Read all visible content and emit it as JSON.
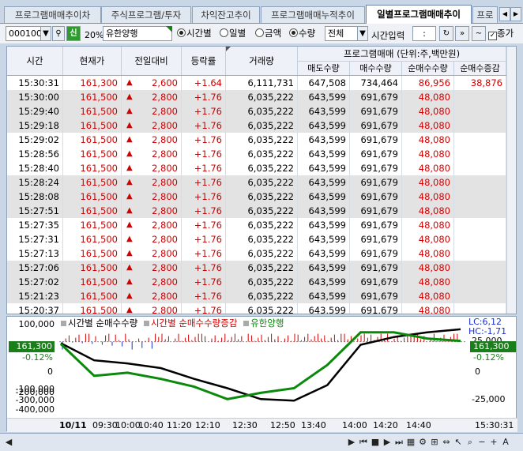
{
  "tabs": [
    {
      "label": "프로그램매매추이차"
    },
    {
      "label": "주식프로그램/투자"
    },
    {
      "label": "차익잔고추이"
    },
    {
      "label": "프로그램매매누적추이"
    },
    {
      "label": "일별프로그램매매추이"
    },
    {
      "label": "프로"
    }
  ],
  "toolbar": {
    "code": "000100",
    "badge_new": "신",
    "margin": "20%",
    "stock_name": "유한양행",
    "radio_time": "시간별",
    "radio_day": "일별",
    "radio_amount": "금액",
    "radio_qty": "수량",
    "filter": "전체",
    "time_input_label": "시간입력",
    "time_value": ":",
    "close_price_label": "종가"
  },
  "table": {
    "headers": {
      "time": "시간",
      "price": "현재가",
      "change": "전일대비",
      "rate": "등락률",
      "volume": "거래량",
      "program_group": "프로그램매매 (단위:주,백만원)",
      "sell": "매도수량",
      "buy": "매수수량",
      "net": "순매수수량",
      "net_delta": "순매수증감"
    },
    "rows": [
      {
        "time": "15:30:31",
        "price": "161,300",
        "change": "2,600",
        "rate": "+1.64",
        "volume": "6,111,731",
        "sell": "647,508",
        "buy": "734,464",
        "net": "86,956",
        "delta": "38,876"
      },
      {
        "time": "15:30:00",
        "price": "161,500",
        "change": "2,800",
        "rate": "+1.76",
        "volume": "6,035,222",
        "sell": "643,599",
        "buy": "691,679",
        "net": "48,080",
        "delta": ""
      },
      {
        "time": "15:29:40",
        "price": "161,500",
        "change": "2,800",
        "rate": "+1.76",
        "volume": "6,035,222",
        "sell": "643,599",
        "buy": "691,679",
        "net": "48,080",
        "delta": ""
      },
      {
        "time": "15:29:18",
        "price": "161,500",
        "change": "2,800",
        "rate": "+1.76",
        "volume": "6,035,222",
        "sell": "643,599",
        "buy": "691,679",
        "net": "48,080",
        "delta": ""
      },
      {
        "time": "15:29:02",
        "price": "161,500",
        "change": "2,800",
        "rate": "+1.76",
        "volume": "6,035,222",
        "sell": "643,599",
        "buy": "691,679",
        "net": "48,080",
        "delta": ""
      },
      {
        "time": "15:28:56",
        "price": "161,500",
        "change": "2,800",
        "rate": "+1.76",
        "volume": "6,035,222",
        "sell": "643,599",
        "buy": "691,679",
        "net": "48,080",
        "delta": ""
      },
      {
        "time": "15:28:40",
        "price": "161,500",
        "change": "2,800",
        "rate": "+1.76",
        "volume": "6,035,222",
        "sell": "643,599",
        "buy": "691,679",
        "net": "48,080",
        "delta": ""
      },
      {
        "time": "15:28:24",
        "price": "161,500",
        "change": "2,800",
        "rate": "+1.76",
        "volume": "6,035,222",
        "sell": "643,599",
        "buy": "691,679",
        "net": "48,080",
        "delta": ""
      },
      {
        "time": "15:28:08",
        "price": "161,500",
        "change": "2,800",
        "rate": "+1.76",
        "volume": "6,035,222",
        "sell": "643,599",
        "buy": "691,679",
        "net": "48,080",
        "delta": ""
      },
      {
        "time": "15:27:51",
        "price": "161,500",
        "change": "2,800",
        "rate": "+1.76",
        "volume": "6,035,222",
        "sell": "643,599",
        "buy": "691,679",
        "net": "48,080",
        "delta": ""
      },
      {
        "time": "15:27:35",
        "price": "161,500",
        "change": "2,800",
        "rate": "+1.76",
        "volume": "6,035,222",
        "sell": "643,599",
        "buy": "691,679",
        "net": "48,080",
        "delta": ""
      },
      {
        "time": "15:27:31",
        "price": "161,500",
        "change": "2,800",
        "rate": "+1.76",
        "volume": "6,035,222",
        "sell": "643,599",
        "buy": "691,679",
        "net": "48,080",
        "delta": ""
      },
      {
        "time": "15:27:13",
        "price": "161,500",
        "change": "2,800",
        "rate": "+1.76",
        "volume": "6,035,222",
        "sell": "643,599",
        "buy": "691,679",
        "net": "48,080",
        "delta": ""
      },
      {
        "time": "15:27:06",
        "price": "161,500",
        "change": "2,800",
        "rate": "+1.76",
        "volume": "6,035,222",
        "sell": "643,599",
        "buy": "691,679",
        "net": "48,080",
        "delta": ""
      },
      {
        "time": "15:27:02",
        "price": "161,500",
        "change": "2,800",
        "rate": "+1.76",
        "volume": "6,035,222",
        "sell": "643,599",
        "buy": "691,679",
        "net": "48,080",
        "delta": ""
      },
      {
        "time": "15:21:23",
        "price": "161,500",
        "change": "2,800",
        "rate": "+1.76",
        "volume": "6,035,222",
        "sell": "643,599",
        "buy": "691,679",
        "net": "48,080",
        "delta": ""
      },
      {
        "time": "15:20:37",
        "price": "161,500",
        "change": "2,800",
        "rate": "+1.76",
        "volume": "6,035,222",
        "sell": "643,599",
        "buy": "691,679",
        "net": "48,080",
        "delta": ""
      }
    ]
  },
  "chart": {
    "legend_net": "시간별 순매수수량",
    "legend_delta": "시간별 순매수수량증감",
    "legend_price": "유한양행",
    "left_ticks": [
      "100,000",
      "0",
      "-100,000",
      "-200,000",
      "-300,000",
      "-400,000"
    ],
    "right_ticks": [
      "25,000",
      "0",
      "-25,000"
    ],
    "left_price": "161,300",
    "left_pct": "-0.12%",
    "right_price": "161,300",
    "right_pct": "-0.12%",
    "lc": "LC:6,12",
    "hc": "HC:-1,71",
    "x_labels": [
      "10/11",
      "09:30",
      "10:00",
      "10:40",
      "11:20",
      "12:10",
      "12:30",
      "12:50",
      "13:40",
      "14:00",
      "14:20",
      "14:40"
    ],
    "x_end": "15:30:31"
  },
  "chart_data": {
    "type": "line",
    "x_labels": [
      "10/11",
      "09:30",
      "10:00",
      "10:40",
      "11:20",
      "12:10",
      "12:30",
      "12:50",
      "13:40",
      "14:00",
      "14:20",
      "14:40"
    ],
    "series": [
      {
        "name": "시간별 순매수수량",
        "values": [
          -10000,
          -120000,
          -140000,
          -170000,
          -240000,
          -300000,
          -370000,
          -380000,
          -280000,
          -20000,
          30000,
          60000,
          80000
        ]
      },
      {
        "name": "유한양행",
        "values": [
          -15000,
          -220000,
          -200000,
          -240000,
          -290000,
          -370000,
          -330000,
          -300000,
          -150000,
          60000,
          60000,
          20000,
          5000
        ]
      }
    ],
    "ylim": [
      -450000,
      120000
    ],
    "colors": {
      "net": "#000000",
      "price": "#0a8a0a",
      "delta": "#d40000",
      "delta_neg": "#1a2fd0"
    }
  },
  "colors": {
    "up": "#d40000",
    "accent_green": "#1a7f1a"
  }
}
